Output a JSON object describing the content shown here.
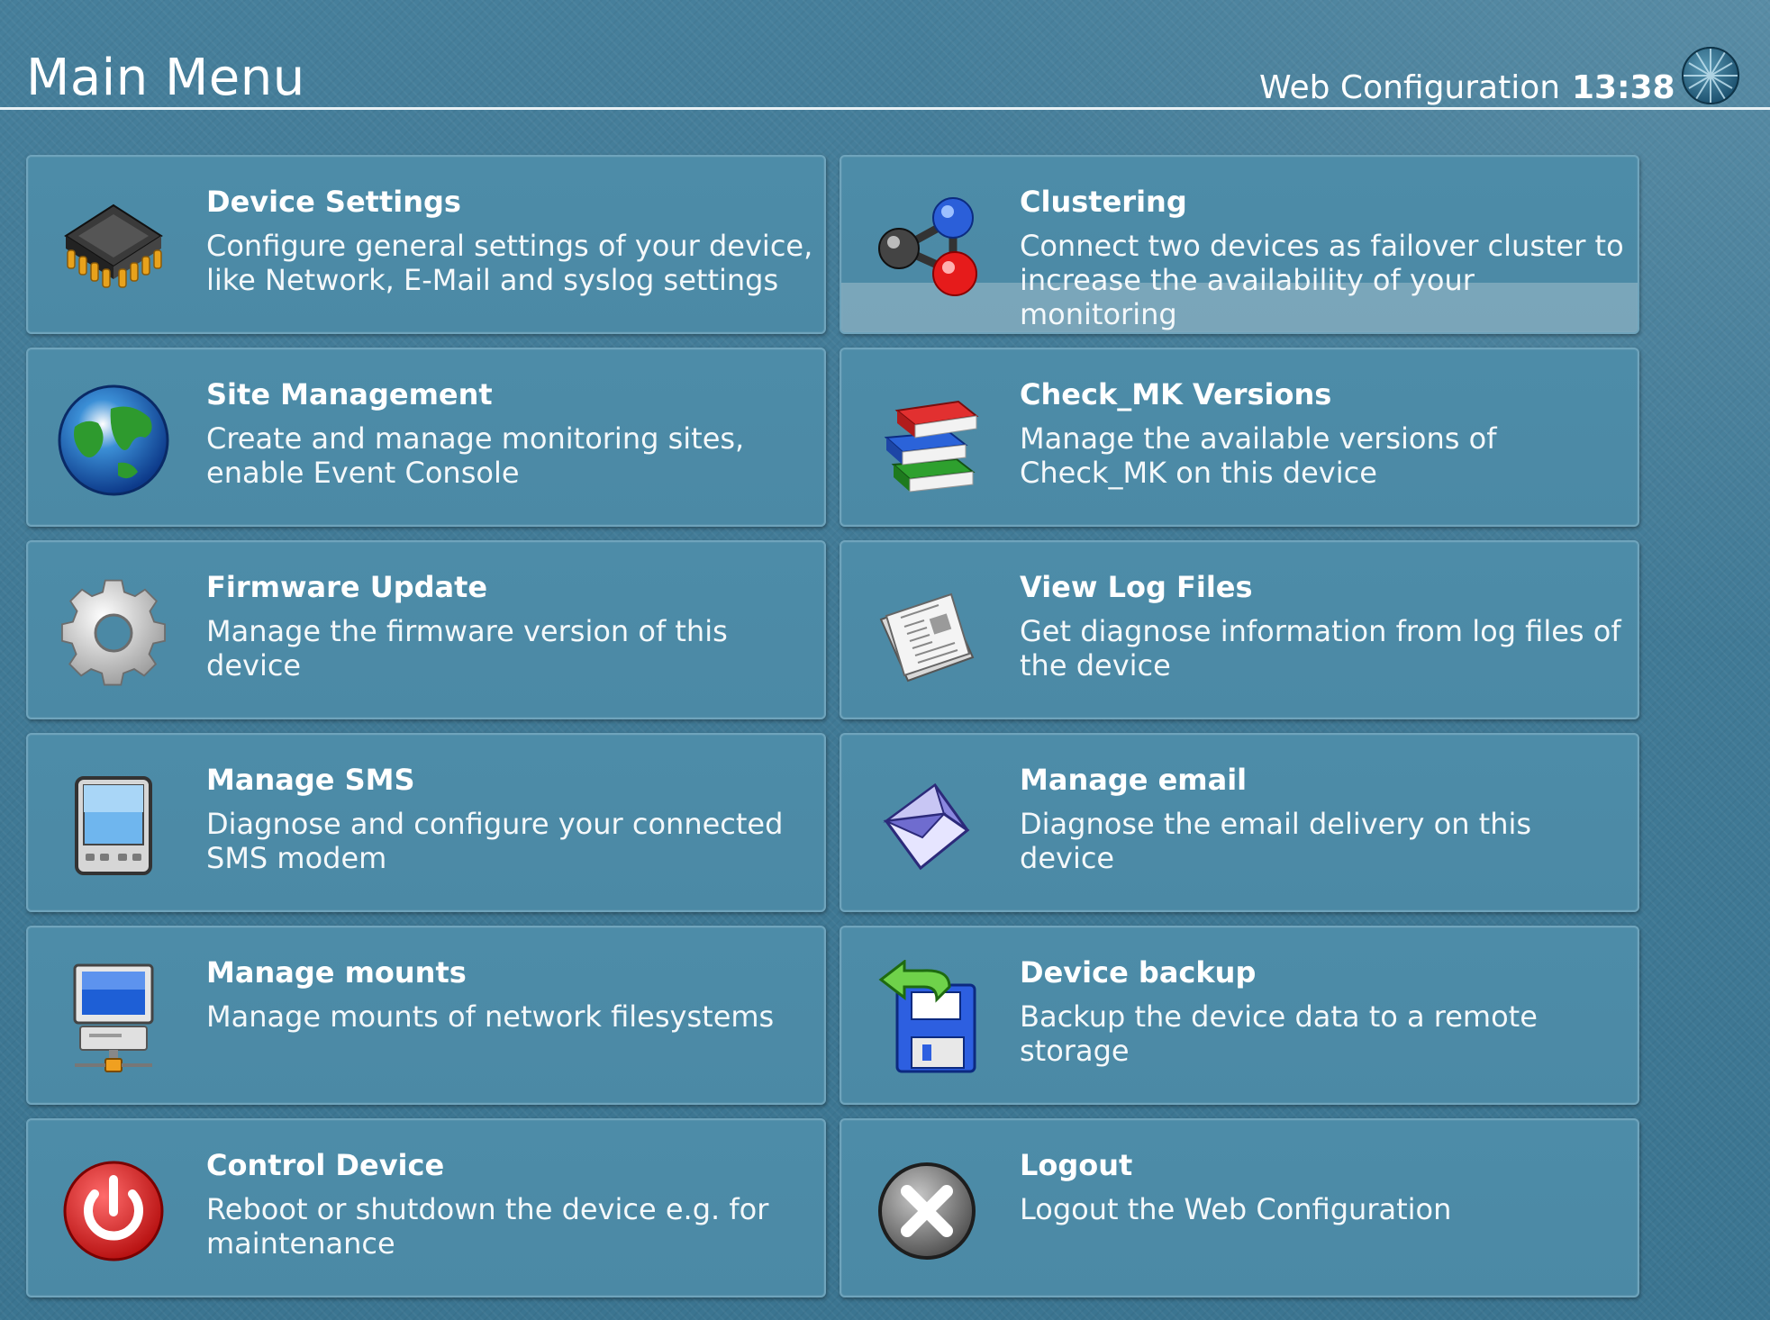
{
  "header": {
    "title": "Main Menu",
    "app_name": "Web Configuration",
    "clock": "13:38"
  },
  "tiles": [
    {
      "id": "device-settings",
      "title": "Device Settings",
      "description": "Configure general settings of your device, like Network, E-Mail and syslog settings",
      "icon": "chip-icon"
    },
    {
      "id": "clustering",
      "title": "Clustering",
      "description": "Connect two devices as failover cluster to increase the availability of your monitoring",
      "icon": "cluster-icon"
    },
    {
      "id": "site-management",
      "title": "Site Management",
      "description": "Create and manage monitoring sites, enable Event Console",
      "icon": "globe-icon"
    },
    {
      "id": "checkmk-versions",
      "title": "Check_MK Versions",
      "description": "Manage the available versions of Check_MK on this device",
      "icon": "books-icon"
    },
    {
      "id": "firmware-update",
      "title": "Firmware Update",
      "description": "Manage the firmware version of this device",
      "icon": "gear-icon"
    },
    {
      "id": "view-log-files",
      "title": "View Log Files",
      "description": "Get diagnose information from log files of the device",
      "icon": "newspaper-icon"
    },
    {
      "id": "manage-sms",
      "title": "Manage SMS",
      "description": "Diagnose and configure your connected SMS modem",
      "icon": "pda-icon"
    },
    {
      "id": "manage-email",
      "title": "Manage email",
      "description": "Diagnose the email delivery on this device",
      "icon": "envelope-icon"
    },
    {
      "id": "manage-mounts",
      "title": "Manage mounts",
      "description": "Manage mounts of network filesystems",
      "icon": "network-computer-icon"
    },
    {
      "id": "device-backup",
      "title": "Device backup",
      "description": "Backup the device data to a remote storage",
      "icon": "floppy-backup-icon"
    },
    {
      "id": "control-device",
      "title": "Control Device",
      "description": "Reboot or shutdown the device e.g. for maintenance",
      "icon": "power-icon"
    },
    {
      "id": "logout",
      "title": "Logout",
      "description": "Logout the Web Configuration",
      "icon": "close-icon"
    }
  ],
  "colors": {
    "background": "#3f7e9a",
    "tile": "#4b89a5",
    "tile_border": "#6fa4bc",
    "text": "#ffffff"
  }
}
